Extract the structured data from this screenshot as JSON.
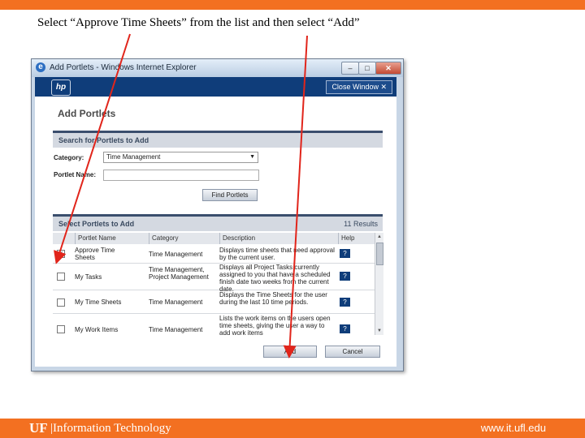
{
  "instruction": "Select “Approve Time Sheets” from the list and then select “Add”",
  "window": {
    "title": "Add Portlets - Windows Internet Explorer",
    "minimize": "–",
    "maximize": "□",
    "close": "✕"
  },
  "header": {
    "logo": "hp",
    "close_window": "Close Window ✕"
  },
  "page_title": "Add Portlets",
  "search": {
    "heading": "Search for Portlets to Add",
    "category_label": "Category:",
    "category_value": "Time Management",
    "portlet_name_label": "Portlet Name:",
    "portlet_name_value": "",
    "find_button": "Find Portlets"
  },
  "results": {
    "heading": "Select Portlets to Add",
    "count": "11 Results",
    "columns": [
      "Portlet Name",
      "Category",
      "Description",
      "Help"
    ],
    "rows": [
      {
        "checked": true,
        "name": "Approve Time Sheets",
        "category": "Time Management",
        "description": "Displays time sheets that need approval by the current user.",
        "help": "?"
      },
      {
        "checked": false,
        "name": "My Tasks",
        "category": "Time Management, Project Management",
        "description": "Displays all Project Tasks currently assigned to you that have a scheduled finish date two weeks from the current date.",
        "help": "?"
      },
      {
        "checked": false,
        "name": "My Time Sheets",
        "category": "Time Management",
        "description": "Displays the Time Sheets for the user during the last 10 time periods.",
        "help": "?"
      },
      {
        "checked": false,
        "name": "My Work Items",
        "category": "Time Management",
        "description": "Lists the work items on the users open time sheets, giving the user a way to add work items",
        "help": "?"
      }
    ]
  },
  "buttons": {
    "add": "Add",
    "cancel": "Cancel"
  },
  "footer": {
    "logo": "UF",
    "department": "|Information Technology",
    "url": "www.it.ufl.edu"
  },
  "colors": {
    "uf_orange": "#f37021",
    "header_blue": "#0f3d7a",
    "annotation_red": "#e1251b"
  }
}
